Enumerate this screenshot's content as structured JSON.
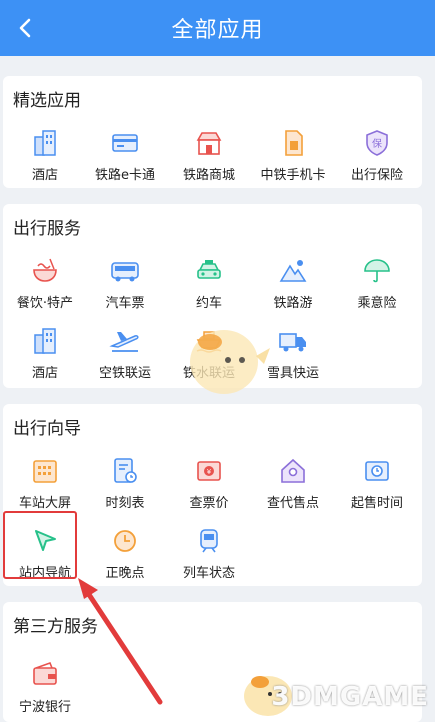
{
  "header": {
    "title": "全部应用"
  },
  "sections": [
    {
      "title": "精选应用",
      "items": [
        {
          "label": "酒店",
          "icon": "hotel-icon"
        },
        {
          "label": "铁路e卡通",
          "icon": "card-icon"
        },
        {
          "label": "铁路商城",
          "icon": "shop-icon"
        },
        {
          "label": "中铁手机卡",
          "icon": "sim-card-icon"
        },
        {
          "label": "出行保险",
          "icon": "insurance-shield-icon"
        }
      ]
    },
    {
      "title": "出行服务",
      "items": [
        {
          "label": "餐饮·特产",
          "icon": "noodle-bowl-icon"
        },
        {
          "label": "汽车票",
          "icon": "bus-icon"
        },
        {
          "label": "约车",
          "icon": "taxi-icon"
        },
        {
          "label": "铁路游",
          "icon": "mountain-icon"
        },
        {
          "label": "乘意险",
          "icon": "umbrella-icon"
        },
        {
          "label": "酒店",
          "icon": "hotel-icon"
        },
        {
          "label": "空铁联运",
          "icon": "plane-icon"
        },
        {
          "label": "铁水联运",
          "icon": "ship-icon"
        },
        {
          "label": "雪具快运",
          "icon": "truck-icon"
        }
      ]
    },
    {
      "title": "出行向导",
      "items": [
        {
          "label": "车站大屏",
          "icon": "screen-grid-icon"
        },
        {
          "label": "时刻表",
          "icon": "timetable-icon"
        },
        {
          "label": "查票价",
          "icon": "ticket-price-icon"
        },
        {
          "label": "查代售点",
          "icon": "house-location-icon"
        },
        {
          "label": "起售时间",
          "icon": "ticket-time-icon"
        },
        {
          "label": "站内导航",
          "icon": "navigation-arrow-icon"
        },
        {
          "label": "正晚点",
          "icon": "clock-icon"
        },
        {
          "label": "列车状态",
          "icon": "train-icon"
        }
      ]
    },
    {
      "title": "第三方服务",
      "items": [
        {
          "label": "宁波银行",
          "icon": "wallet-icon"
        }
      ]
    }
  ],
  "watermark": "3DMGAME",
  "colors": {
    "header": "#3d91f5",
    "icon_blue": "#4a8ff0",
    "icon_green": "#27c18a",
    "icon_red": "#e8534e",
    "icon_orange": "#f3a03a",
    "highlight": "#e23b3b"
  }
}
